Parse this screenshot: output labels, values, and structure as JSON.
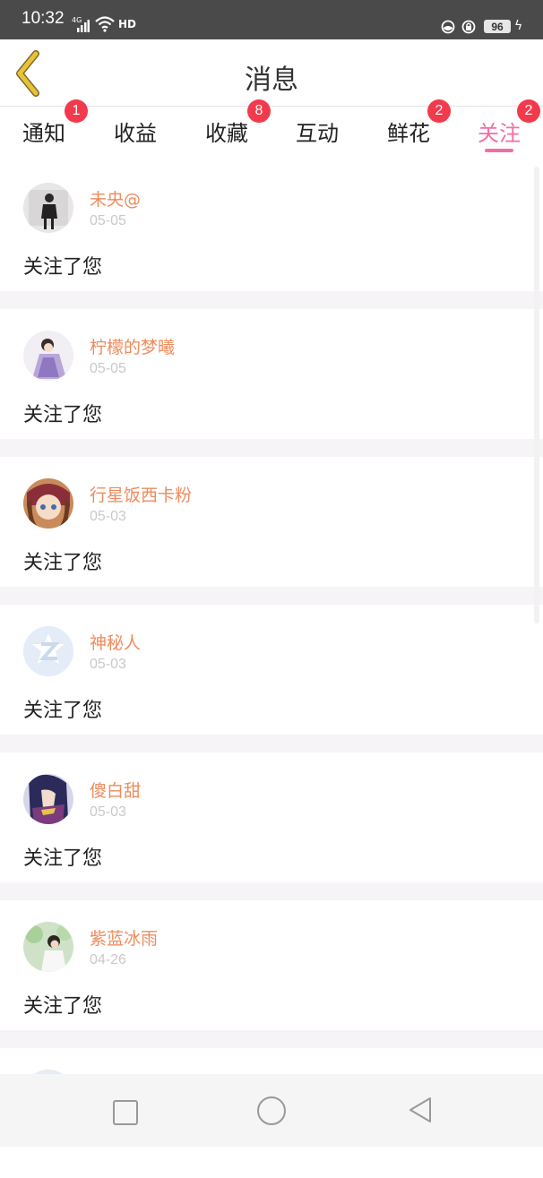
{
  "status_bar": {
    "time": "10:32",
    "network": "4G",
    "hd": "HD",
    "battery": "96"
  },
  "header": {
    "title": "消息"
  },
  "tabs": [
    {
      "label": "通知",
      "badge": "1",
      "active": false
    },
    {
      "label": "收益",
      "badge": "",
      "active": false
    },
    {
      "label": "收藏",
      "badge": "8",
      "active": false
    },
    {
      "label": "互动",
      "badge": "",
      "active": false
    },
    {
      "label": "鲜花",
      "badge": "2",
      "active": false
    },
    {
      "label": "关注",
      "badge": "2",
      "active": true
    }
  ],
  "follows": [
    {
      "name": "未央@",
      "date": "05-05",
      "action": "关注了您"
    },
    {
      "name": "柠檬的梦曦",
      "date": "05-05",
      "action": "关注了您"
    },
    {
      "name": "行星饭西卡粉",
      "date": "05-03",
      "action": "关注了您"
    },
    {
      "name": "神秘人",
      "date": "05-03",
      "action": "关注了您"
    },
    {
      "name": "傻白甜",
      "date": "05-03",
      "action": "关注了您"
    },
    {
      "name": "紫蓝冰雨",
      "date": "04-26",
      "action": "关注了您"
    }
  ],
  "colors": {
    "accent_pink": "#ef6fa6",
    "username_orange": "#ef8b5d",
    "badge_red": "#f23a4c",
    "back_arrow": "#e8c23a"
  }
}
